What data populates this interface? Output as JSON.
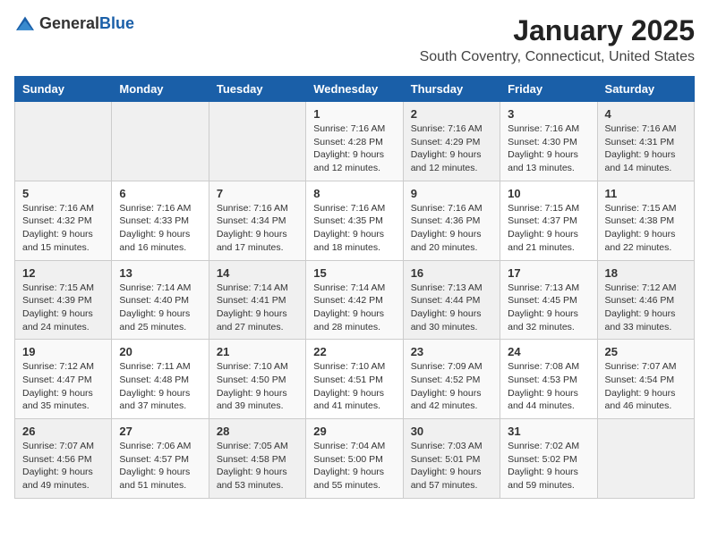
{
  "header": {
    "logo_general": "General",
    "logo_blue": "Blue",
    "month_title": "January 2025",
    "location": "South Coventry, Connecticut, United States"
  },
  "weekdays": [
    "Sunday",
    "Monday",
    "Tuesday",
    "Wednesday",
    "Thursday",
    "Friday",
    "Saturday"
  ],
  "weeks": [
    [
      {
        "day": "",
        "content": ""
      },
      {
        "day": "",
        "content": ""
      },
      {
        "day": "",
        "content": ""
      },
      {
        "day": "1",
        "content": "Sunrise: 7:16 AM\nSunset: 4:28 PM\nDaylight: 9 hours\nand 12 minutes."
      },
      {
        "day": "2",
        "content": "Sunrise: 7:16 AM\nSunset: 4:29 PM\nDaylight: 9 hours\nand 12 minutes."
      },
      {
        "day": "3",
        "content": "Sunrise: 7:16 AM\nSunset: 4:30 PM\nDaylight: 9 hours\nand 13 minutes."
      },
      {
        "day": "4",
        "content": "Sunrise: 7:16 AM\nSunset: 4:31 PM\nDaylight: 9 hours\nand 14 minutes."
      }
    ],
    [
      {
        "day": "5",
        "content": "Sunrise: 7:16 AM\nSunset: 4:32 PM\nDaylight: 9 hours\nand 15 minutes."
      },
      {
        "day": "6",
        "content": "Sunrise: 7:16 AM\nSunset: 4:33 PM\nDaylight: 9 hours\nand 16 minutes."
      },
      {
        "day": "7",
        "content": "Sunrise: 7:16 AM\nSunset: 4:34 PM\nDaylight: 9 hours\nand 17 minutes."
      },
      {
        "day": "8",
        "content": "Sunrise: 7:16 AM\nSunset: 4:35 PM\nDaylight: 9 hours\nand 18 minutes."
      },
      {
        "day": "9",
        "content": "Sunrise: 7:16 AM\nSunset: 4:36 PM\nDaylight: 9 hours\nand 20 minutes."
      },
      {
        "day": "10",
        "content": "Sunrise: 7:15 AM\nSunset: 4:37 PM\nDaylight: 9 hours\nand 21 minutes."
      },
      {
        "day": "11",
        "content": "Sunrise: 7:15 AM\nSunset: 4:38 PM\nDaylight: 9 hours\nand 22 minutes."
      }
    ],
    [
      {
        "day": "12",
        "content": "Sunrise: 7:15 AM\nSunset: 4:39 PM\nDaylight: 9 hours\nand 24 minutes."
      },
      {
        "day": "13",
        "content": "Sunrise: 7:14 AM\nSunset: 4:40 PM\nDaylight: 9 hours\nand 25 minutes."
      },
      {
        "day": "14",
        "content": "Sunrise: 7:14 AM\nSunset: 4:41 PM\nDaylight: 9 hours\nand 27 minutes."
      },
      {
        "day": "15",
        "content": "Sunrise: 7:14 AM\nSunset: 4:42 PM\nDaylight: 9 hours\nand 28 minutes."
      },
      {
        "day": "16",
        "content": "Sunrise: 7:13 AM\nSunset: 4:44 PM\nDaylight: 9 hours\nand 30 minutes."
      },
      {
        "day": "17",
        "content": "Sunrise: 7:13 AM\nSunset: 4:45 PM\nDaylight: 9 hours\nand 32 minutes."
      },
      {
        "day": "18",
        "content": "Sunrise: 7:12 AM\nSunset: 4:46 PM\nDaylight: 9 hours\nand 33 minutes."
      }
    ],
    [
      {
        "day": "19",
        "content": "Sunrise: 7:12 AM\nSunset: 4:47 PM\nDaylight: 9 hours\nand 35 minutes."
      },
      {
        "day": "20",
        "content": "Sunrise: 7:11 AM\nSunset: 4:48 PM\nDaylight: 9 hours\nand 37 minutes."
      },
      {
        "day": "21",
        "content": "Sunrise: 7:10 AM\nSunset: 4:50 PM\nDaylight: 9 hours\nand 39 minutes."
      },
      {
        "day": "22",
        "content": "Sunrise: 7:10 AM\nSunset: 4:51 PM\nDaylight: 9 hours\nand 41 minutes."
      },
      {
        "day": "23",
        "content": "Sunrise: 7:09 AM\nSunset: 4:52 PM\nDaylight: 9 hours\nand 42 minutes."
      },
      {
        "day": "24",
        "content": "Sunrise: 7:08 AM\nSunset: 4:53 PM\nDaylight: 9 hours\nand 44 minutes."
      },
      {
        "day": "25",
        "content": "Sunrise: 7:07 AM\nSunset: 4:54 PM\nDaylight: 9 hours\nand 46 minutes."
      }
    ],
    [
      {
        "day": "26",
        "content": "Sunrise: 7:07 AM\nSunset: 4:56 PM\nDaylight: 9 hours\nand 49 minutes."
      },
      {
        "day": "27",
        "content": "Sunrise: 7:06 AM\nSunset: 4:57 PM\nDaylight: 9 hours\nand 51 minutes."
      },
      {
        "day": "28",
        "content": "Sunrise: 7:05 AM\nSunset: 4:58 PM\nDaylight: 9 hours\nand 53 minutes."
      },
      {
        "day": "29",
        "content": "Sunrise: 7:04 AM\nSunset: 5:00 PM\nDaylight: 9 hours\nand 55 minutes."
      },
      {
        "day": "30",
        "content": "Sunrise: 7:03 AM\nSunset: 5:01 PM\nDaylight: 9 hours\nand 57 minutes."
      },
      {
        "day": "31",
        "content": "Sunrise: 7:02 AM\nSunset: 5:02 PM\nDaylight: 9 hours\nand 59 minutes."
      },
      {
        "day": "",
        "content": ""
      }
    ]
  ]
}
